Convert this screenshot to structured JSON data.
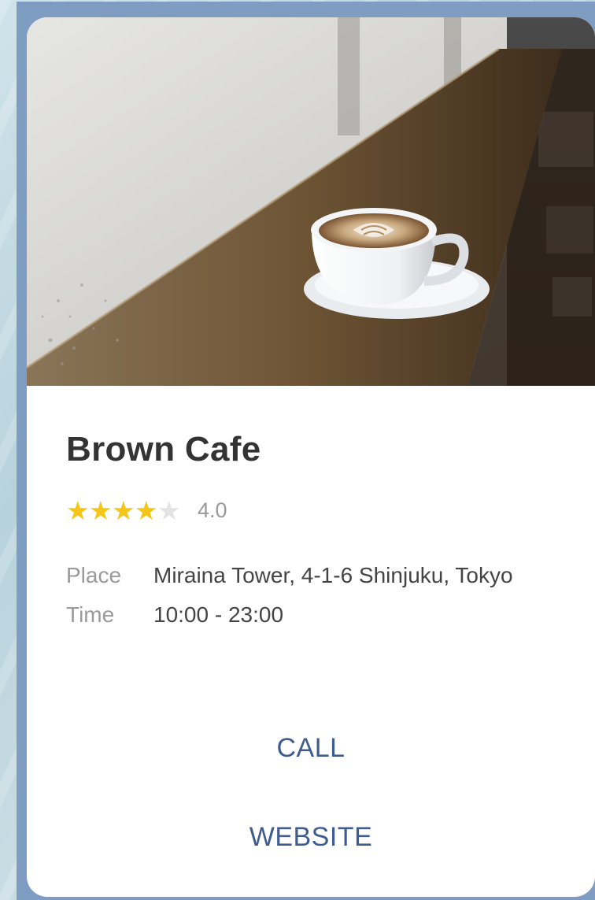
{
  "cafe": {
    "name": "Brown Cafe",
    "rating": 4.0,
    "rating_text": "4.0",
    "stars_filled": 4,
    "stars_total": 5,
    "details": [
      {
        "label": "Place",
        "value": "Miraina Tower, 4-1-6 Shinjuku, Tokyo"
      },
      {
        "label": "Time",
        "value": "10:00 - 23:00"
      }
    ]
  },
  "actions": {
    "call_label": "CALL",
    "website_label": "WEBSITE"
  },
  "icons": {
    "star": "star-icon"
  },
  "colors": {
    "frame": "#7f9cc2",
    "accent": "#3f5c8e",
    "star_on": "#f5c518",
    "star_off": "#e3e3e3"
  }
}
